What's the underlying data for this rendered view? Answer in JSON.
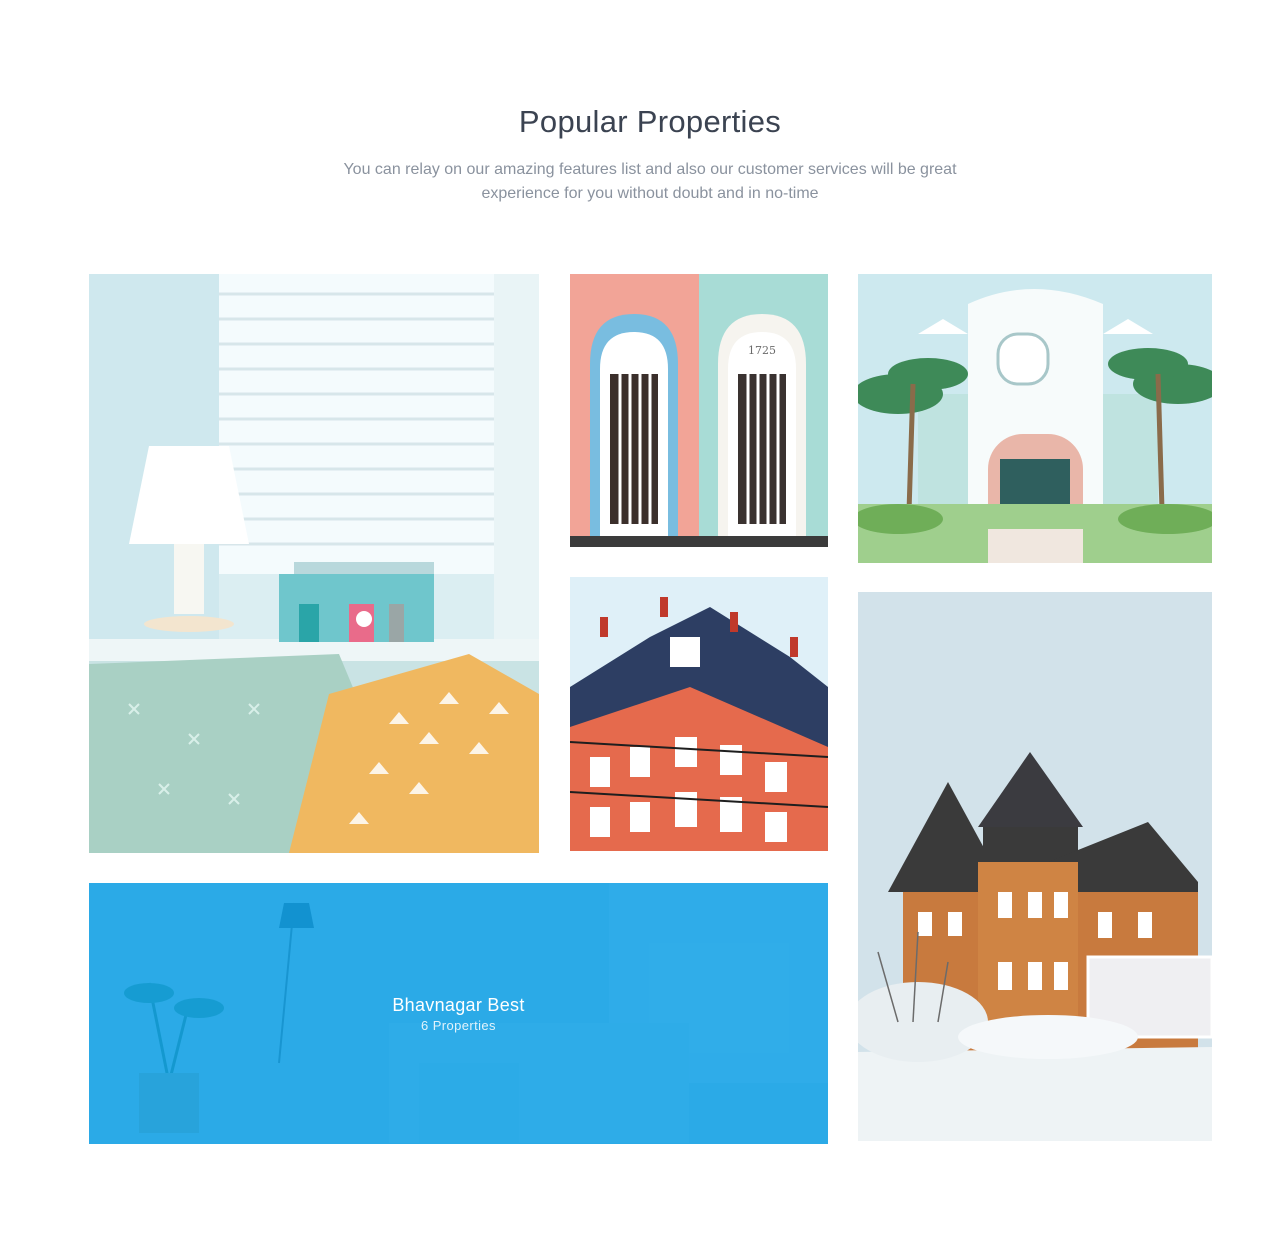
{
  "section": {
    "title": "Popular Properties",
    "subtitle": "You can relay on our amazing features list and also our customer services will be great experience for you without doubt and in no-time"
  },
  "properties": [
    {
      "id": "living",
      "image": "living-room-window-pillows"
    },
    {
      "id": "doors",
      "image": "pink-and-mint-doors",
      "door_number": "1725"
    },
    {
      "id": "villa",
      "image": "white-villa-palm-trees"
    },
    {
      "id": "paris",
      "image": "parisian-corner-building"
    },
    {
      "id": "snow",
      "image": "victorian-house-in-snow"
    }
  ],
  "featured": {
    "title": "Bhavnagar Best",
    "count_label": "6 Properties",
    "overlay_color": "#0E9FE5"
  }
}
